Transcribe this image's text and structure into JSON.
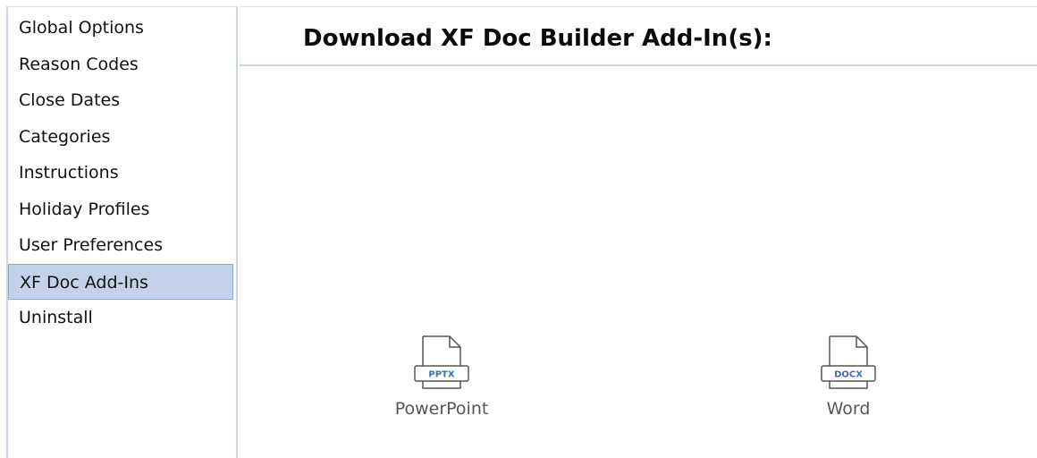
{
  "sidebar": {
    "items": [
      {
        "label": "Global Options"
      },
      {
        "label": "Reason Codes"
      },
      {
        "label": "Close Dates"
      },
      {
        "label": "Categories"
      },
      {
        "label": "Instructions"
      },
      {
        "label": "Holiday Profiles"
      },
      {
        "label": "User Preferences"
      },
      {
        "label": "XF Doc Add-Ins",
        "selected": true
      },
      {
        "label": "Uninstall"
      }
    ]
  },
  "main": {
    "title": "Download XF Doc Builder Add-In(s):",
    "addins": [
      {
        "label": "PowerPoint",
        "badge": "PPTX",
        "icon": "pptx-file-icon"
      },
      {
        "label": "Word",
        "badge": "DOCX",
        "icon": "docx-file-icon"
      }
    ]
  },
  "colors": {
    "selected_bg": "#c3d2ea",
    "border": "#c9d6e7",
    "badge_text": "#3a6fb0"
  }
}
